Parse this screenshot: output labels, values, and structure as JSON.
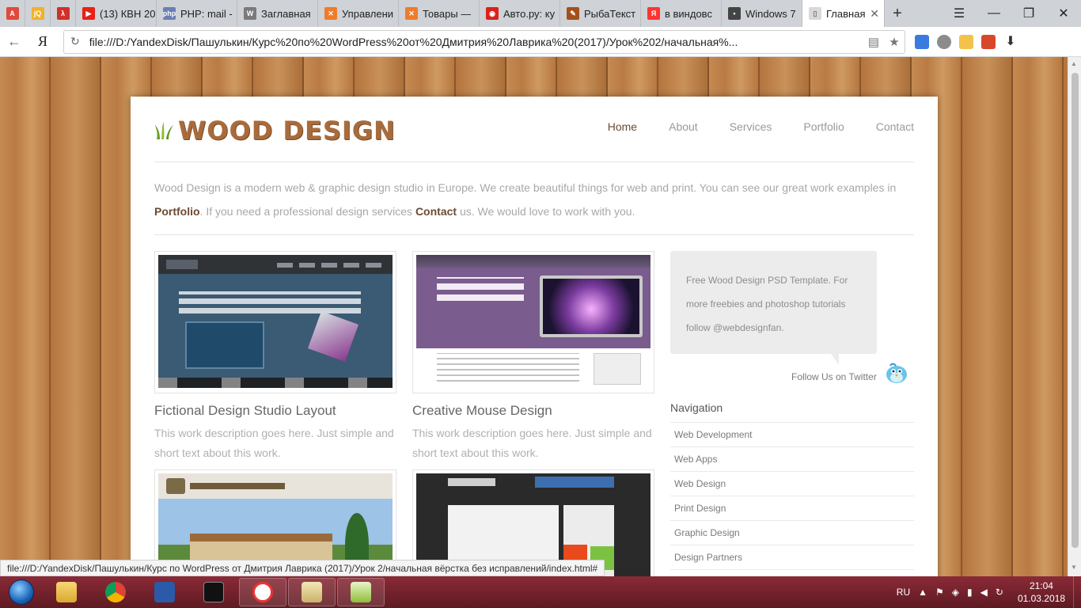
{
  "browser": {
    "tabs": [
      {
        "label": "",
        "icon": "adblock-icon",
        "color": "#e04a3b"
      },
      {
        "label": "",
        "icon": "jquery-icon",
        "color": "#f0b12b"
      },
      {
        "label": "",
        "icon": "tool-icon",
        "color": "#d0302a"
      },
      {
        "label": "(13) КВН 20",
        "icon": "youtube-icon",
        "color": "#e62117"
      },
      {
        "label": "PHP: mail -",
        "icon": "php-icon",
        "color": "#6d7eb5"
      },
      {
        "label": "Заглавная",
        "icon": "wordpress-icon",
        "color": "#7a7a7a"
      },
      {
        "label": "Управлени",
        "icon": "xampp-icon",
        "color": "#f07b2a"
      },
      {
        "label": "Товары —",
        "icon": "xampp-icon",
        "color": "#f07b2a"
      },
      {
        "label": "Авто.ру: ку",
        "icon": "car-icon",
        "color": "#d8221a"
      },
      {
        "label": "РыбаТекст",
        "icon": "fish-icon",
        "color": "#a3501c"
      },
      {
        "label": "в виндовс",
        "icon": "yandex-icon",
        "color": "#ff3333"
      },
      {
        "label": "Windows 7",
        "icon": "site-icon",
        "color": "#444444"
      },
      {
        "label": "Главная",
        "icon": "page-icon",
        "color": "#9a9a9a",
        "active": true
      }
    ],
    "address": {
      "url": "file:///D:/YandexDisk/Пашулькин/Курс%20по%20WordPress%20от%20Дмитрия%20Лаврика%20(2017)/Урок%202/начальная%...",
      "yandex_label": "Я"
    },
    "status_url": "file:///D:/YandexDisk/Пашулькин/Курс по WordPress от Дмитрия Лаврика (2017)/Урок 2/начальная вёрстка без исправлений/index.html#"
  },
  "site": {
    "logo_text": "WOOD DESIGN",
    "nav": [
      {
        "label": "Home",
        "active": true
      },
      {
        "label": "About"
      },
      {
        "label": "Services"
      },
      {
        "label": "Portfolio"
      },
      {
        "label": "Contact"
      }
    ],
    "intro": {
      "part1": "Wood Design is a modern web & graphic design studio in Europe. We create beautiful things for web and print. You can see our great work examples in ",
      "link1": "Portfolio",
      "part2": ". If you need a professional design services ",
      "link2": "Contact",
      "part3": " us. We would love to work with you."
    },
    "works": [
      {
        "title": "Fictional Design Studio Layout",
        "desc": "This work description goes here. Just simple and short text about this work."
      },
      {
        "title": "Creative Mouse Design",
        "desc": "This work description goes here. Just simple and short text about this work."
      }
    ],
    "sidebar": {
      "bubble_line1": "Free Wood Design PSD Template. For",
      "bubble_line2": "more freebies and photoshop tutorials",
      "bubble_line3": "follow @webdesignfan.",
      "follow_text": "Follow Us on Twitter",
      "nav_heading": "Navigation",
      "nav_items": [
        "Web Development",
        "Web Apps",
        "Web Design",
        "Print Design",
        "Graphic Design",
        "Design Partners"
      ]
    }
  },
  "taskbar": {
    "language": "RU",
    "time": "21:04",
    "date": "01.03.2018"
  }
}
